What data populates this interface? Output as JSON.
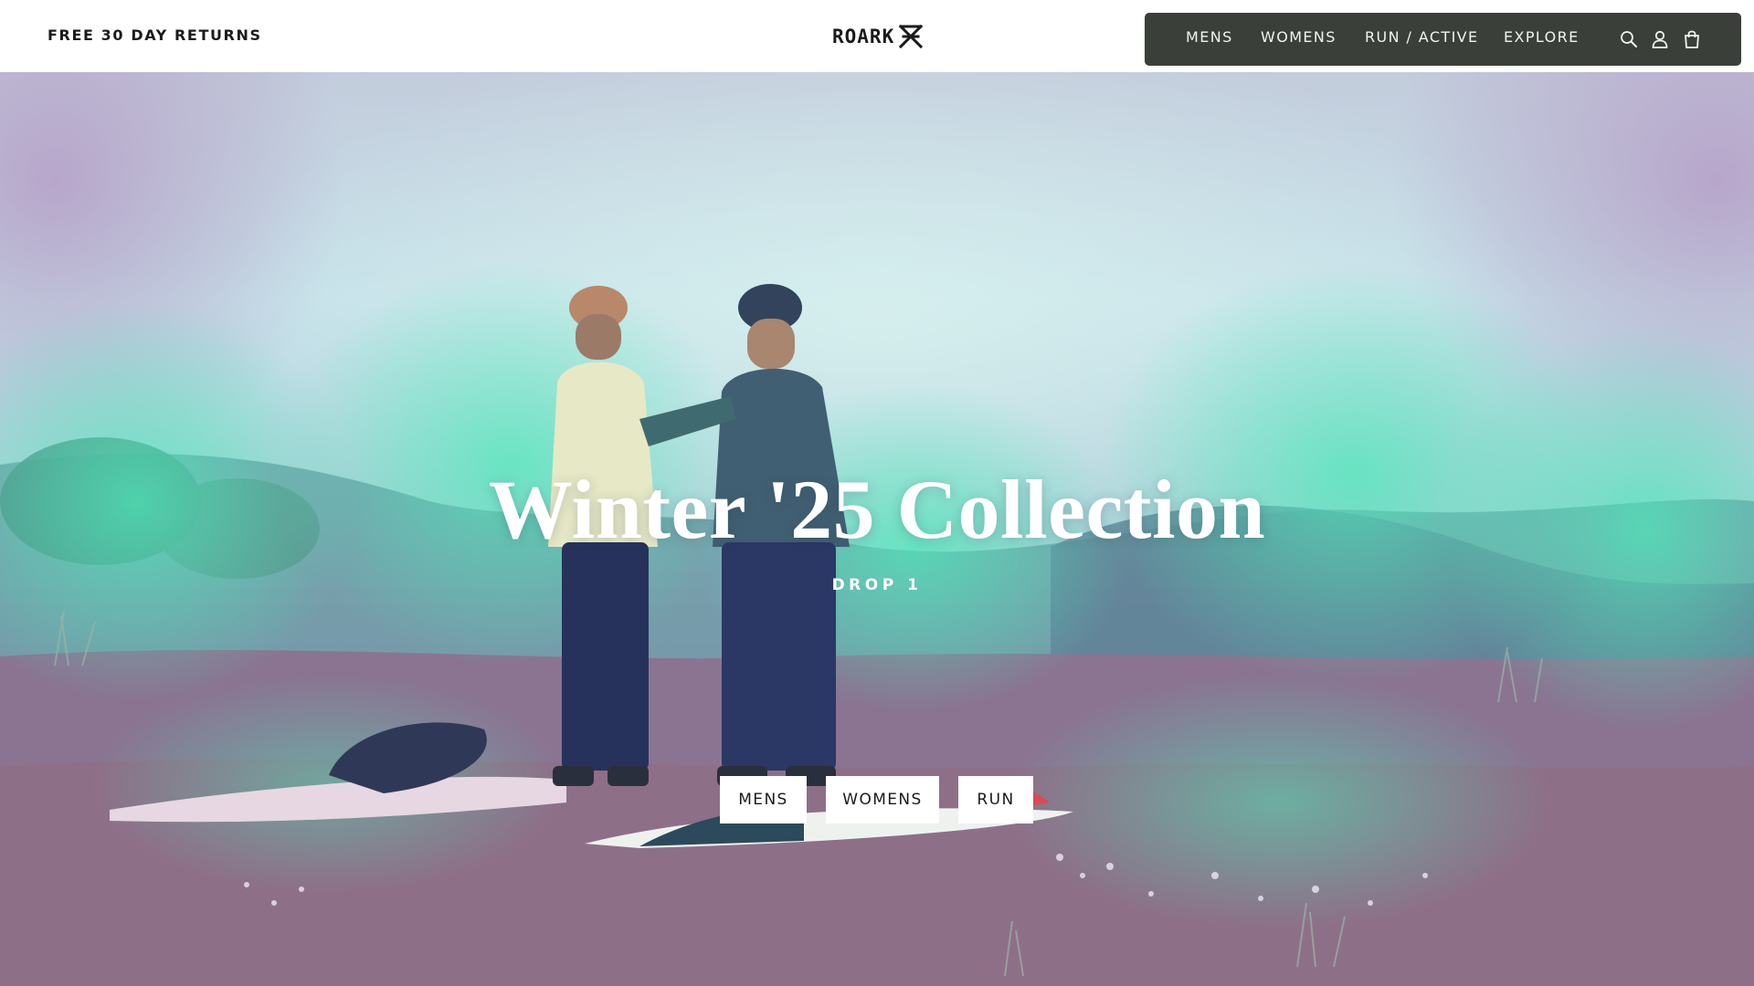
{
  "header": {
    "promo_text": "FREE 30 DAY RETURNS",
    "logo_text": "ROARK",
    "logo_icon": "roark-mark-icon",
    "nav": {
      "items": [
        {
          "label": "MENS"
        },
        {
          "label": "WOMENS"
        },
        {
          "label": "RUN / ACTIVE"
        },
        {
          "label": "EXPLORE"
        }
      ],
      "icons": [
        "search-icon",
        "account-icon",
        "cart-icon"
      ]
    }
  },
  "hero": {
    "title": "Winter '25 Collection",
    "subtitle": "DROP 1",
    "buttons": [
      {
        "label": "MENS"
      },
      {
        "label": "WOMENS"
      },
      {
        "label": "RUN"
      }
    ]
  },
  "colors": {
    "nav_background": "#3a4039",
    "nav_text": "#f3f3ee",
    "header_background": "#ffffff",
    "hero_text": "#ffffff",
    "button_background": "#ffffff",
    "hero_mint_glow": "#4ee8b8",
    "hero_sky": "#c6e4ec",
    "hero_ground": "#8d7190"
  }
}
